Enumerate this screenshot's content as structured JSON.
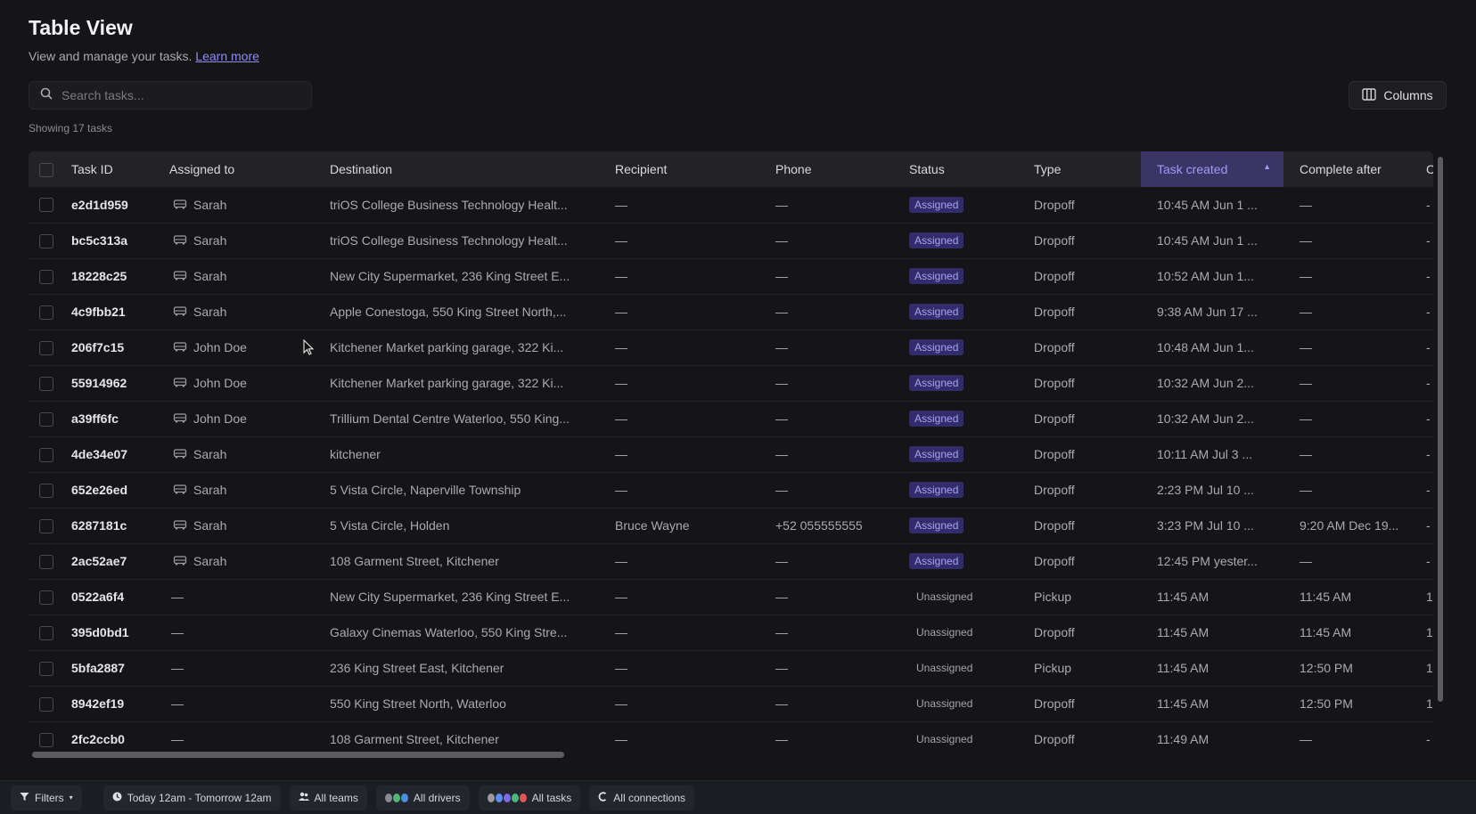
{
  "header": {
    "title": "Table View",
    "subtitle": "View and manage your tasks.",
    "learn_more": "Learn more"
  },
  "search": {
    "placeholder": "Search tasks..."
  },
  "columns_button": {
    "label": "Columns"
  },
  "showing": "Showing 17 tasks",
  "table": {
    "columns": [
      "Task ID",
      "Assigned to",
      "Destination",
      "Recipient",
      "Phone",
      "Status",
      "Type",
      "Task created",
      "Complete after",
      "C"
    ],
    "sorted_column": "Task created",
    "rows": [
      {
        "id": "e2d1d959",
        "assigned": "Sarah",
        "destination": "triOS College Business Technology Healt...",
        "recipient": "—",
        "phone": "—",
        "status": "Assigned",
        "type": "Dropoff",
        "created": "10:45 AM Jun 1 ...",
        "complete_after": "—",
        "c": "-"
      },
      {
        "id": "bc5c313a",
        "assigned": "Sarah",
        "destination": "triOS College Business Technology Healt...",
        "recipient": "—",
        "phone": "—",
        "status": "Assigned",
        "type": "Dropoff",
        "created": "10:45 AM Jun 1 ...",
        "complete_after": "—",
        "c": "-"
      },
      {
        "id": "18228c25",
        "assigned": "Sarah",
        "destination": "New City Supermarket, 236 King Street E...",
        "recipient": "—",
        "phone": "—",
        "status": "Assigned",
        "type": "Dropoff",
        "created": "10:52 AM Jun 1...",
        "complete_after": "—",
        "c": "-"
      },
      {
        "id": "4c9fbb21",
        "assigned": "Sarah",
        "destination": "Apple Conestoga, 550 King Street North,...",
        "recipient": "—",
        "phone": "—",
        "status": "Assigned",
        "type": "Dropoff",
        "created": "9:38 AM Jun 17 ...",
        "complete_after": "—",
        "c": "-"
      },
      {
        "id": "206f7c15",
        "assigned": "John Doe",
        "destination": "Kitchener Market parking garage, 322 Ki...",
        "recipient": "—",
        "phone": "—",
        "status": "Assigned",
        "type": "Dropoff",
        "created": "10:48 AM Jun 1...",
        "complete_after": "—",
        "c": "-"
      },
      {
        "id": "55914962",
        "assigned": "John Doe",
        "destination": "Kitchener Market parking garage, 322 Ki...",
        "recipient": "—",
        "phone": "—",
        "status": "Assigned",
        "type": "Dropoff",
        "created": "10:32 AM Jun 2...",
        "complete_after": "—",
        "c": "-"
      },
      {
        "id": "a39ff6fc",
        "assigned": "John Doe",
        "destination": "Trillium Dental Centre Waterloo, 550 King...",
        "recipient": "—",
        "phone": "—",
        "status": "Assigned",
        "type": "Dropoff",
        "created": "10:32 AM Jun 2...",
        "complete_after": "—",
        "c": "-"
      },
      {
        "id": "4de34e07",
        "assigned": "Sarah",
        "destination": "kitchener",
        "recipient": "—",
        "phone": "—",
        "status": "Assigned",
        "type": "Dropoff",
        "created": "10:11 AM Jul 3 ...",
        "complete_after": "—",
        "c": "-"
      },
      {
        "id": "652e26ed",
        "assigned": "Sarah",
        "destination": "5 Vista Circle, Naperville Township",
        "recipient": "—",
        "phone": "—",
        "status": "Assigned",
        "type": "Dropoff",
        "created": "2:23 PM Jul 10 ...",
        "complete_after": "—",
        "c": "-"
      },
      {
        "id": "6287181c",
        "assigned": "Sarah",
        "destination": "5 Vista Circle, Holden",
        "recipient": "Bruce Wayne",
        "phone": "+52 055555555",
        "status": "Assigned",
        "type": "Dropoff",
        "created": "3:23 PM Jul 10 ...",
        "complete_after": "9:20 AM Dec 19...",
        "c": "-"
      },
      {
        "id": "2ac52ae7",
        "assigned": "Sarah",
        "destination": "108 Garment Street, Kitchener",
        "recipient": "—",
        "phone": "—",
        "status": "Assigned",
        "type": "Dropoff",
        "created": "12:45 PM yester...",
        "complete_after": "—",
        "c": "-"
      },
      {
        "id": "0522a6f4",
        "assigned": "—",
        "destination": "New City Supermarket, 236 King Street E...",
        "recipient": "—",
        "phone": "—",
        "status": "Unassigned",
        "type": "Pickup",
        "created": "11:45 AM",
        "complete_after": "11:45 AM",
        "c": "1"
      },
      {
        "id": "395d0bd1",
        "assigned": "—",
        "destination": "Galaxy Cinemas Waterloo, 550 King Stre...",
        "recipient": "—",
        "phone": "—",
        "status": "Unassigned",
        "type": "Dropoff",
        "created": "11:45 AM",
        "complete_after": "11:45 AM",
        "c": "1"
      },
      {
        "id": "5bfa2887",
        "assigned": "—",
        "destination": "236 King Street East, Kitchener",
        "recipient": "—",
        "phone": "—",
        "status": "Unassigned",
        "type": "Pickup",
        "created": "11:45 AM",
        "complete_after": "12:50 PM",
        "c": "1"
      },
      {
        "id": "8942ef19",
        "assigned": "—",
        "destination": "550 King Street North, Waterloo",
        "recipient": "—",
        "phone": "—",
        "status": "Unassigned",
        "type": "Dropoff",
        "created": "11:45 AM",
        "complete_after": "12:50 PM",
        "c": "1"
      },
      {
        "id": "2fc2ccb0",
        "assigned": "—",
        "destination": "108 Garment Street, Kitchener",
        "recipient": "—",
        "phone": "—",
        "status": "Unassigned",
        "type": "Dropoff",
        "created": "11:49 AM",
        "complete_after": "—",
        "c": "-"
      }
    ]
  },
  "bottom_bar": {
    "filters": "Filters",
    "date_range": "Today 12am - Tomorrow 12am",
    "teams": "All teams",
    "drivers": "All drivers",
    "tasks": "All tasks",
    "connections": "All connections"
  },
  "colors": {
    "accent": "#8e8cf5",
    "badge_bg": "#322c6b",
    "background": "#151517"
  },
  "icons": {
    "search": "search-icon",
    "columns": "columns-icon",
    "vehicle": "car-icon",
    "sort": "sort-asc-icon",
    "filter": "filter-icon",
    "clock": "clock-icon",
    "teams": "teams-icon",
    "connections": "connections-icon"
  }
}
